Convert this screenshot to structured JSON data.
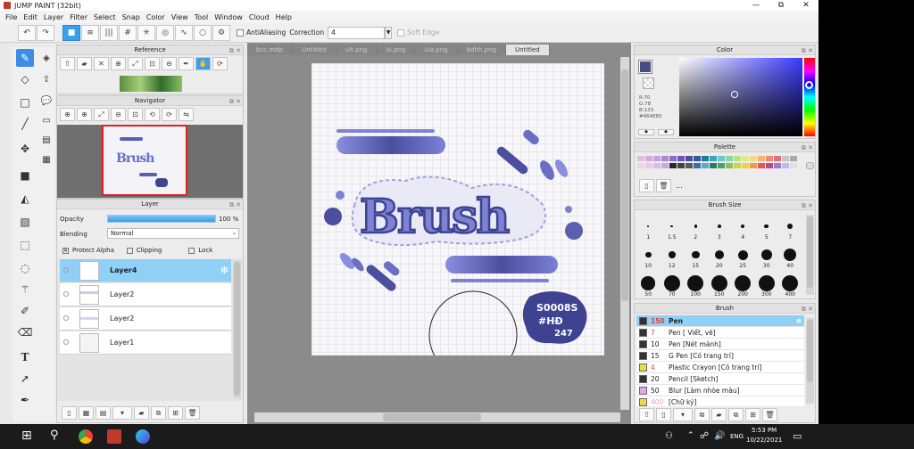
{
  "app": {
    "title": "JUMP PAINT (32bit)",
    "min": "—",
    "max": "⧉",
    "close": "✕"
  },
  "menu": [
    "File",
    "Edit",
    "Layer",
    "Filter",
    "Select",
    "Snap",
    "Color",
    "View",
    "Tool",
    "Window",
    "Cloud",
    "Help"
  ],
  "toolbar": {
    "antialiasing": "AntiAliasing",
    "correction_label": "Correction",
    "correction_value": "4",
    "softedge": "Soft Edge"
  },
  "reference_panel": {
    "title": "Reference"
  },
  "navigator_panel": {
    "title": "Navigator"
  },
  "layer_panel": {
    "title": "Layer",
    "opacity_label": "Opacity",
    "opacity_value": "100 %",
    "opacity_percent": 100,
    "blending_label": "Blending",
    "blending_value": "Normal",
    "protect_alpha": "Protect Alpha",
    "clipping": "Clipping",
    "lock": "Lock",
    "layers": [
      {
        "name": "Layer4",
        "selected": true
      },
      {
        "name": "Layer2",
        "selected": false
      },
      {
        "name": "Layer2",
        "selected": false
      },
      {
        "name": "Layer1",
        "selected": false
      }
    ]
  },
  "doc_tabs": [
    "bcc.mdp",
    "Untitled",
    "ult.png",
    "lu.png",
    "ula.png",
    "bdhh.png",
    "Untitled"
  ],
  "canvas_art": {
    "word": "Brush",
    "stamp_line1": "S0008S",
    "stamp_line2": "#HĐ",
    "stamp_line3": "247"
  },
  "color_panel": {
    "title": "Color",
    "r": "R:70",
    "g": "G:78",
    "b": "B:133",
    "hex": "#464E85",
    "current": "#464e85"
  },
  "palette_panel": {
    "title": "Palette",
    "more": "...",
    "row1": [
      "#e9b8d6",
      "#d7a8e2",
      "#c9a0d9",
      "#a88bd0",
      "#8f6ac5",
      "#6e55b3",
      "#4a4e9c",
      "#2f5b8f",
      "#227a9c",
      "#3aa3b8",
      "#6fc6c0",
      "#8bd6a6",
      "#b8e28f",
      "#e3e88f",
      "#f1d98c",
      "#f3b17c",
      "#ec8a7a",
      "#e0707b",
      "#c6c6c6",
      "#a9a9a9"
    ],
    "row2": [
      "#f5d3e6",
      "#e7c6f0",
      "#d7bbe8",
      "#c1acdf",
      "#2b2b2b",
      "#444444",
      "#5a5a5a",
      "#3b6fa8",
      "#5fa8d3",
      "#2d7d5a",
      "#4aa36b",
      "#87c35a",
      "#c6d84a",
      "#f0cf4a",
      "#f09a4a",
      "#e05a5a",
      "#b84a8e",
      "#9b7bd8",
      "#c9b4ef",
      "#e0e0e0"
    ]
  },
  "brushsize_panel": {
    "title": "Brush Size",
    "sizes": [
      "1",
      "1.5",
      "2",
      "3",
      "4",
      "5",
      "7",
      "10",
      "12",
      "15",
      "20",
      "25",
      "30",
      "40",
      "50",
      "70",
      "100",
      "150",
      "200",
      "300",
      "400"
    ]
  },
  "brush_panel": {
    "title": "Brush",
    "items": [
      {
        "size": "150",
        "name": "Pen",
        "color": "#333333",
        "selected": true
      },
      {
        "size": "7",
        "name": "Pen [ Viết, vẽ]",
        "color": "#333333",
        "selected": false
      },
      {
        "size": "10",
        "name": "Pen [Nét mảnh]",
        "color": "#333333",
        "selected": false
      },
      {
        "size": "15",
        "name": "G Pen [Có trang trí]",
        "color": "#333333",
        "selected": false
      },
      {
        "size": "4",
        "name": "Plastic Crayon [Có trang trí]",
        "color": "#e8d84a",
        "selected": false
      },
      {
        "size": "20",
        "name": "Pencil [Sketch]",
        "color": "#333333",
        "selected": false
      },
      {
        "size": "50",
        "name": "Blur [Làm nhòe màu]",
        "color": "#e7a3e8",
        "selected": false
      },
      {
        "size": "400",
        "name": "[Chữ ký]",
        "color": "#e8d84a",
        "selected": false
      }
    ]
  },
  "taskbar": {
    "time": "5:53 PM",
    "date": "10/22/2021",
    "lang": "ENG"
  }
}
